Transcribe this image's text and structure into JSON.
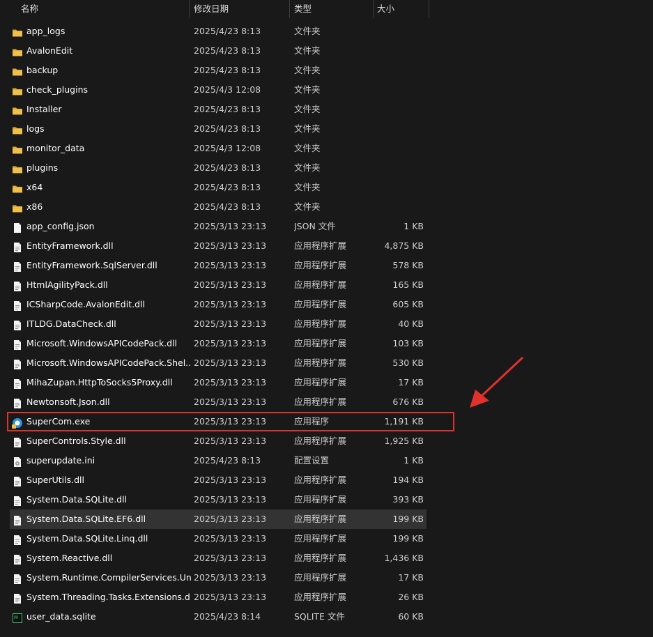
{
  "columns": {
    "name": "名称",
    "date": "修改日期",
    "type": "类型",
    "size": "大小"
  },
  "colors": {
    "background": "#191919",
    "folder": "#f0c04a",
    "highlight": "#e0312c",
    "selected_row": "#333333"
  },
  "files": [
    {
      "name": "app_logs",
      "date": "2025/4/23 8:13",
      "type": "文件夹",
      "size": "",
      "icon": "folder-icon"
    },
    {
      "name": "AvalonEdit",
      "date": "2025/4/23 8:13",
      "type": "文件夹",
      "size": "",
      "icon": "folder-icon"
    },
    {
      "name": "backup",
      "date": "2025/4/23 8:13",
      "type": "文件夹",
      "size": "",
      "icon": "folder-icon"
    },
    {
      "name": "check_plugins",
      "date": "2025/4/3 12:08",
      "type": "文件夹",
      "size": "",
      "icon": "folder-icon"
    },
    {
      "name": "Installer",
      "date": "2025/4/23 8:13",
      "type": "文件夹",
      "size": "",
      "icon": "folder-icon"
    },
    {
      "name": "logs",
      "date": "2025/4/23 8:13",
      "type": "文件夹",
      "size": "",
      "icon": "folder-icon"
    },
    {
      "name": "monitor_data",
      "date": "2025/4/3 12:08",
      "type": "文件夹",
      "size": "",
      "icon": "folder-icon"
    },
    {
      "name": "plugins",
      "date": "2025/4/23 8:13",
      "type": "文件夹",
      "size": "",
      "icon": "folder-icon"
    },
    {
      "name": "x64",
      "date": "2025/4/23 8:13",
      "type": "文件夹",
      "size": "",
      "icon": "folder-icon"
    },
    {
      "name": "x86",
      "date": "2025/4/23 8:13",
      "type": "文件夹",
      "size": "",
      "icon": "folder-icon"
    },
    {
      "name": "app_config.json",
      "date": "2025/3/13 23:13",
      "type": "JSON 文件",
      "size": "1 KB",
      "icon": "file-icon"
    },
    {
      "name": "EntityFramework.dll",
      "date": "2025/3/13 23:13",
      "type": "应用程序扩展",
      "size": "4,875 KB",
      "icon": "dll-icon"
    },
    {
      "name": "EntityFramework.SqlServer.dll",
      "date": "2025/3/13 23:13",
      "type": "应用程序扩展",
      "size": "578 KB",
      "icon": "dll-icon"
    },
    {
      "name": "HtmlAgilityPack.dll",
      "date": "2025/3/13 23:13",
      "type": "应用程序扩展",
      "size": "165 KB",
      "icon": "dll-icon"
    },
    {
      "name": "ICSharpCode.AvalonEdit.dll",
      "date": "2025/3/13 23:13",
      "type": "应用程序扩展",
      "size": "605 KB",
      "icon": "dll-icon"
    },
    {
      "name": "ITLDG.DataCheck.dll",
      "date": "2025/3/13 23:13",
      "type": "应用程序扩展",
      "size": "40 KB",
      "icon": "dll-icon"
    },
    {
      "name": "Microsoft.WindowsAPICodePack.dll",
      "date": "2025/3/13 23:13",
      "type": "应用程序扩展",
      "size": "103 KB",
      "icon": "dll-icon"
    },
    {
      "name": "Microsoft.WindowsAPICodePack.Shel...",
      "date": "2025/3/13 23:13",
      "type": "应用程序扩展",
      "size": "530 KB",
      "icon": "dll-icon"
    },
    {
      "name": "MihaZupan.HttpToSocks5Proxy.dll",
      "date": "2025/3/13 23:13",
      "type": "应用程序扩展",
      "size": "17 KB",
      "icon": "dll-icon"
    },
    {
      "name": "Newtonsoft.Json.dll",
      "date": "2025/3/13 23:13",
      "type": "应用程序扩展",
      "size": "676 KB",
      "icon": "dll-icon"
    },
    {
      "name": "SuperCom.exe",
      "date": "2025/3/13 23:13",
      "type": "应用程序",
      "size": "1,191 KB",
      "icon": "app-icon"
    },
    {
      "name": "SuperControls.Style.dll",
      "date": "2025/3/13 23:13",
      "type": "应用程序扩展",
      "size": "1,925 KB",
      "icon": "dll-icon"
    },
    {
      "name": "superupdate.ini",
      "date": "2025/4/23 8:13",
      "type": "配置设置",
      "size": "1 KB",
      "icon": "ini-icon"
    },
    {
      "name": "SuperUtils.dll",
      "date": "2025/3/13 23:13",
      "type": "应用程序扩展",
      "size": "194 KB",
      "icon": "dll-icon"
    },
    {
      "name": "System.Data.SQLite.dll",
      "date": "2025/3/13 23:13",
      "type": "应用程序扩展",
      "size": "393 KB",
      "icon": "dll-icon"
    },
    {
      "name": "System.Data.SQLite.EF6.dll",
      "date": "2025/3/13 23:13",
      "type": "应用程序扩展",
      "size": "199 KB",
      "icon": "dll-icon",
      "selected": true
    },
    {
      "name": "System.Data.SQLite.Linq.dll",
      "date": "2025/3/13 23:13",
      "type": "应用程序扩展",
      "size": "199 KB",
      "icon": "dll-icon"
    },
    {
      "name": "System.Reactive.dll",
      "date": "2025/3/13 23:13",
      "type": "应用程序扩展",
      "size": "1,436 KB",
      "icon": "dll-icon"
    },
    {
      "name": "System.Runtime.CompilerServices.Un...",
      "date": "2025/3/13 23:13",
      "type": "应用程序扩展",
      "size": "17 KB",
      "icon": "dll-icon"
    },
    {
      "name": "System.Threading.Tasks.Extensions.dll",
      "date": "2025/3/13 23:13",
      "type": "应用程序扩展",
      "size": "26 KB",
      "icon": "dll-icon"
    },
    {
      "name": "user_data.sqlite",
      "date": "2025/4/23 8:14",
      "type": "SQLITE 文件",
      "size": "60 KB",
      "icon": "sqlite-icon"
    }
  ]
}
